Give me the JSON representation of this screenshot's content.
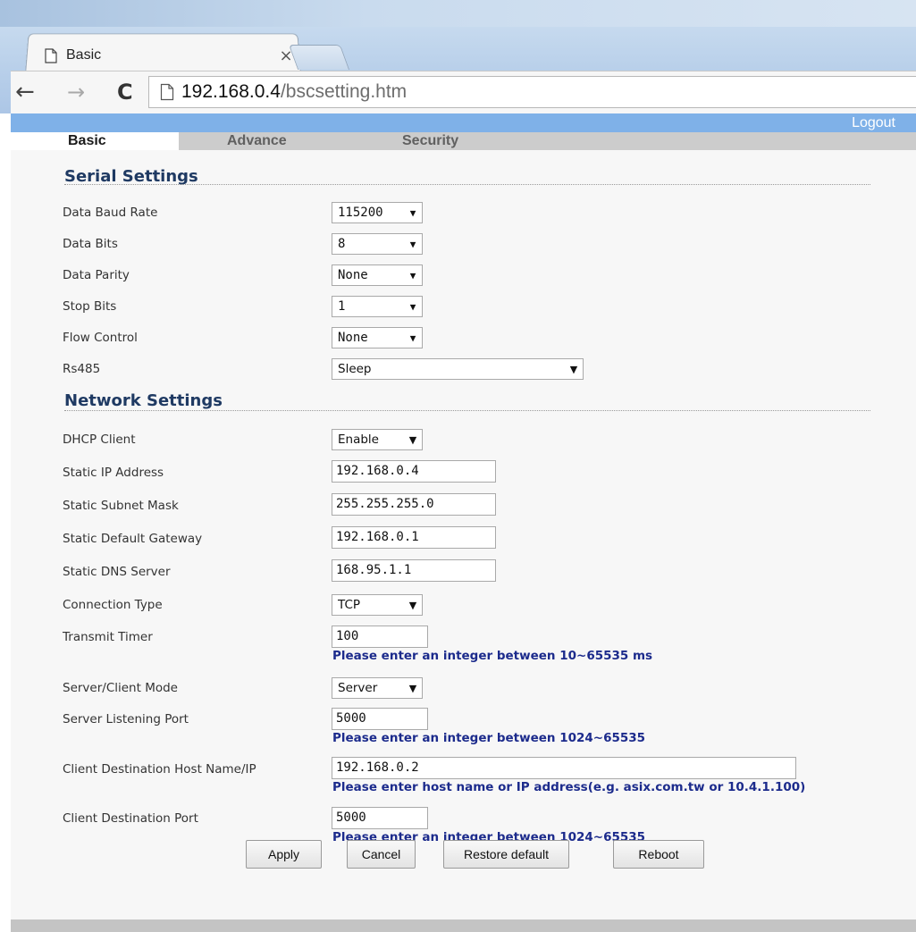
{
  "browser": {
    "tab_title": "Basic",
    "tab_close": "×",
    "url_host": "192.168.0.4",
    "url_path": "/bscsetting.htm",
    "back": "←",
    "forward": "→",
    "reload": "C"
  },
  "header": {
    "logout": "Logout",
    "tabs": [
      "Basic",
      "Advance",
      "Security"
    ]
  },
  "serial": {
    "title": "Serial Settings",
    "fields": [
      {
        "label": "Data Baud Rate",
        "value": "115200"
      },
      {
        "label": "Data Bits",
        "value": "8"
      },
      {
        "label": "Data Parity",
        "value": "None"
      },
      {
        "label": "Stop Bits",
        "value": "1"
      },
      {
        "label": "Flow Control",
        "value": "None"
      },
      {
        "label": "Rs485",
        "value": "Sleep"
      }
    ]
  },
  "network": {
    "title": "Network Settings",
    "dhcp": {
      "label": "DHCP Client",
      "value": "Enable"
    },
    "ip": {
      "label": "Static IP Address",
      "value": "192.168.0.4"
    },
    "mask": {
      "label": "Static Subnet Mask",
      "value": "255.255.255.0"
    },
    "gateway": {
      "label": "Static Default Gateway",
      "value": "192.168.0.1"
    },
    "dns": {
      "label": "Static DNS Server",
      "value": "168.95.1.1"
    },
    "conn_type": {
      "label": "Connection Type",
      "value": "TCP"
    },
    "timer": {
      "label": "Transmit Timer",
      "value": "100",
      "hint": "Please enter an integer between 10~65535 ms"
    },
    "mode": {
      "label": "Server/Client Mode",
      "value": "Server"
    },
    "listen_port": {
      "label": "Server Listening Port",
      "value": "5000",
      "hint": "Please enter an integer between 1024~65535"
    },
    "dest_host": {
      "label": "Client Destination Host Name/IP",
      "value": "192.168.0.2",
      "hint": "Please enter host name or IP address(e.g. asix.com.tw or 10.4.1.100)"
    },
    "dest_port": {
      "label": "Client Destination Port",
      "value": "5000",
      "hint": "Please enter an integer between 1024~65535"
    }
  },
  "buttons": {
    "apply": "Apply",
    "cancel": "Cancel",
    "restore": "Restore default",
    "reboot": "Reboot"
  },
  "icons": {
    "dropdown": "▼"
  }
}
